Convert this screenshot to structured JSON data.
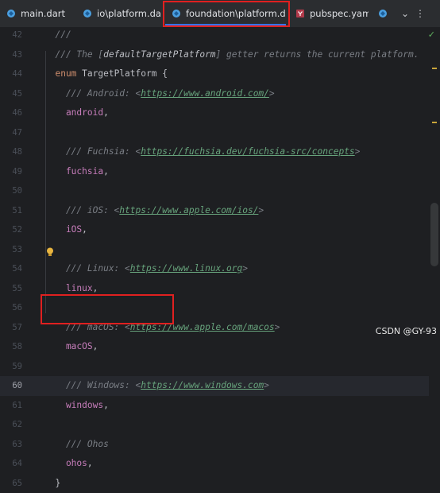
{
  "tabs": [
    {
      "label": "main.dart",
      "icon": "dart-file-icon"
    },
    {
      "label": "io\\platform.dart",
      "icon": "dart-file-icon"
    },
    {
      "label": "foundation\\platform.dart",
      "icon": "dart-file-icon",
      "active": true,
      "close": "×"
    },
    {
      "label": "pubspec.yaml",
      "icon": "yaml-file-icon"
    },
    {
      "label": "",
      "icon": "dart-file-icon"
    }
  ],
  "tab_controls": {
    "more_tabs": "⌄",
    "menu": "⋮"
  },
  "editor": {
    "lines": [
      {
        "n": "42",
        "parts": [
          [
            "cmt",
            "  ///"
          ]
        ]
      },
      {
        "n": "43",
        "parts": [
          [
            "cmt",
            "  /// The ["
          ],
          [
            "ref",
            "defaultTargetPlatform"
          ],
          [
            "cmt",
            "] getter returns the current platform."
          ]
        ]
      },
      {
        "n": "44",
        "parts": [
          [
            "kw",
            "  enum "
          ],
          [
            "cls",
            "TargetPlatform {"
          ]
        ]
      },
      {
        "n": "45",
        "parts": [
          [
            "cmt",
            "    /// Android: <"
          ],
          [
            "doc",
            "https://www.android.com/"
          ],
          [
            "cmt",
            ">"
          ]
        ]
      },
      {
        "n": "46",
        "parts": [
          [
            "enumv",
            "    android"
          ],
          [
            "punc",
            ","
          ]
        ]
      },
      {
        "n": "47",
        "parts": []
      },
      {
        "n": "48",
        "parts": [
          [
            "cmt",
            "    /// Fuchsia: <"
          ],
          [
            "doc",
            "https://fuchsia.dev/fuchsia-src/concepts"
          ],
          [
            "cmt",
            ">"
          ]
        ]
      },
      {
        "n": "49",
        "parts": [
          [
            "enumv",
            "    fuchsia"
          ],
          [
            "punc",
            ","
          ]
        ]
      },
      {
        "n": "50",
        "parts": []
      },
      {
        "n": "51",
        "parts": [
          [
            "cmt",
            "    /// iOS: <"
          ],
          [
            "doc",
            "https://www.apple.com/ios/"
          ],
          [
            "cmt",
            ">"
          ]
        ]
      },
      {
        "n": "52",
        "parts": [
          [
            "enumv",
            "    iOS"
          ],
          [
            "punc",
            ","
          ]
        ]
      },
      {
        "n": "53",
        "parts": []
      },
      {
        "n": "54",
        "parts": [
          [
            "cmt",
            "    /// Linux: <"
          ],
          [
            "doc",
            "https://www.linux.org"
          ],
          [
            "cmt",
            ">"
          ]
        ]
      },
      {
        "n": "55",
        "parts": [
          [
            "enumv",
            "    linux"
          ],
          [
            "punc",
            ","
          ]
        ]
      },
      {
        "n": "56",
        "parts": []
      },
      {
        "n": "57",
        "parts": [
          [
            "cmt",
            "    /// macOS: <"
          ],
          [
            "doc",
            "https://www.apple.com/macos"
          ],
          [
            "cmt",
            ">"
          ]
        ]
      },
      {
        "n": "58",
        "parts": [
          [
            "enumv",
            "    macOS"
          ],
          [
            "punc",
            ","
          ]
        ]
      },
      {
        "n": "59",
        "parts": []
      },
      {
        "n": "60",
        "parts": [
          [
            "cmt",
            "    /// Windows: <"
          ],
          [
            "doc",
            "https://www.windows.com"
          ],
          [
            "cmt",
            ">"
          ]
        ],
        "current": true
      },
      {
        "n": "61",
        "parts": [
          [
            "enumv",
            "    windows"
          ],
          [
            "punc",
            ","
          ]
        ]
      },
      {
        "n": "62",
        "parts": []
      },
      {
        "n": "63",
        "parts": [
          [
            "cmt",
            "    /// Ohos"
          ]
        ]
      },
      {
        "n": "64",
        "parts": [
          [
            "enumv",
            "    ohos"
          ],
          [
            "punc",
            ","
          ]
        ]
      },
      {
        "n": "65",
        "parts": [
          [
            "punc",
            "  }"
          ]
        ]
      }
    ],
    "inspection_status": "✓"
  },
  "watermark": "CSDN @GY-93",
  "colors": {
    "accent": "#3574f0",
    "highlight_box": "#e02020"
  }
}
